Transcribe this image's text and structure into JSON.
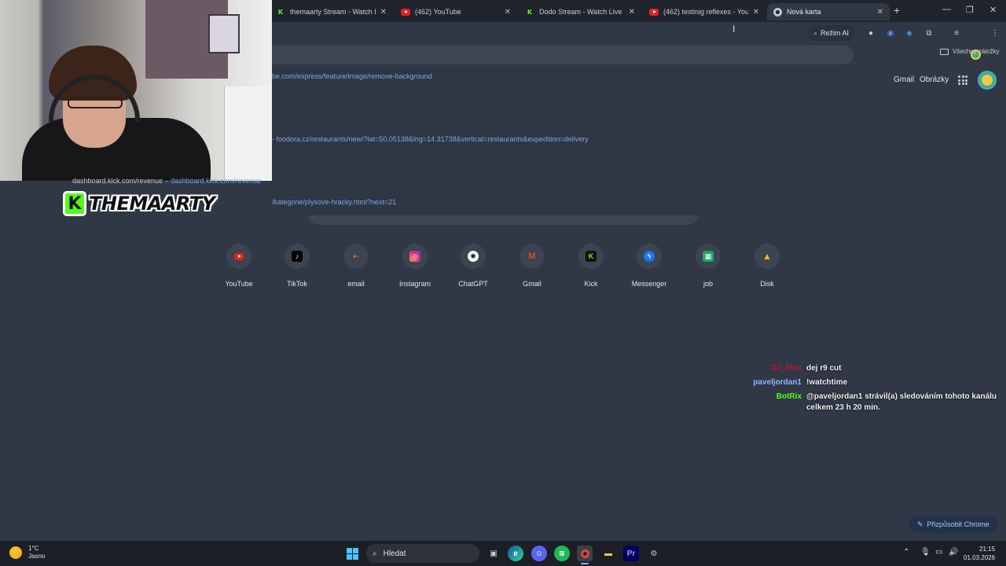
{
  "browser": {
    "tabs": [
      {
        "title": "themaarty Stream - Watch Live",
        "favicon": "kick"
      },
      {
        "title": "(462) YouTube",
        "favicon": "youtube"
      },
      {
        "title": "Dodo Stream - Watch Live on K",
        "favicon": "kick"
      },
      {
        "title": "(462) testinig reflexes - YouTub",
        "favicon": "youtube"
      },
      {
        "title": "Nová karta",
        "favicon": "chrome",
        "active": true
      }
    ],
    "ai_mode_label": "Režim AI",
    "bookmarks_label": "Všechny záložky",
    "omnibox_suggestions": [
      "be.com/express/feature/image/remove-background",
      "- foodora.cz/restaurants/new/?lat=50.05138&lng=14.31738&vertical=restaurants&expedition=delivery",
      "/kategorie/plysove-hracky.html?next=21"
    ],
    "dash_suggestion": {
      "text": "dashboard.kick.com/revenue",
      "url": "dashboard.kick.com/revenue"
    }
  },
  "header_links": {
    "gmail": "Gmail",
    "images": "Obrázky"
  },
  "shortcuts": [
    {
      "label": "YouTube",
      "icon": "youtube-icon"
    },
    {
      "label": "TikTok",
      "icon": "tiktok-icon"
    },
    {
      "label": "email",
      "icon": "email-icon"
    },
    {
      "label": "Instagram",
      "icon": "instagram-icon"
    },
    {
      "label": "ChatGPT",
      "icon": "chatgpt-icon"
    },
    {
      "label": "Gmail",
      "icon": "gmail-icon"
    },
    {
      "label": "Kick",
      "icon": "kick-icon"
    },
    {
      "label": "Messenger",
      "icon": "messenger-icon"
    },
    {
      "label": "job",
      "icon": "sheets-icon"
    },
    {
      "label": "Disk",
      "icon": "drive-icon"
    }
  ],
  "overlay": {
    "channel_name": "THEMAARTY"
  },
  "chat": [
    {
      "user": "DJ_Flex",
      "color": "#c8102e",
      "message": "dej r9 cut"
    },
    {
      "user": "paveljordan1",
      "color": "#8fb4ff",
      "message": "!watchtime"
    },
    {
      "user": "BotRix",
      "color": "#53fc18",
      "message": "@paveljordan1 strávil(a) sledováním tohoto kanálu celkem 23 h 20 min."
    }
  ],
  "customize_label": "Přizpůsobit Chrome",
  "taskbar": {
    "weather_temp": "1°C",
    "weather_desc": "Jasno",
    "search_placeholder": "Hledat",
    "time": "21:15",
    "date": "01.03.2026"
  },
  "colors": {
    "kick_green": "#53fc18",
    "accent_blue": "#a8c7fa"
  }
}
